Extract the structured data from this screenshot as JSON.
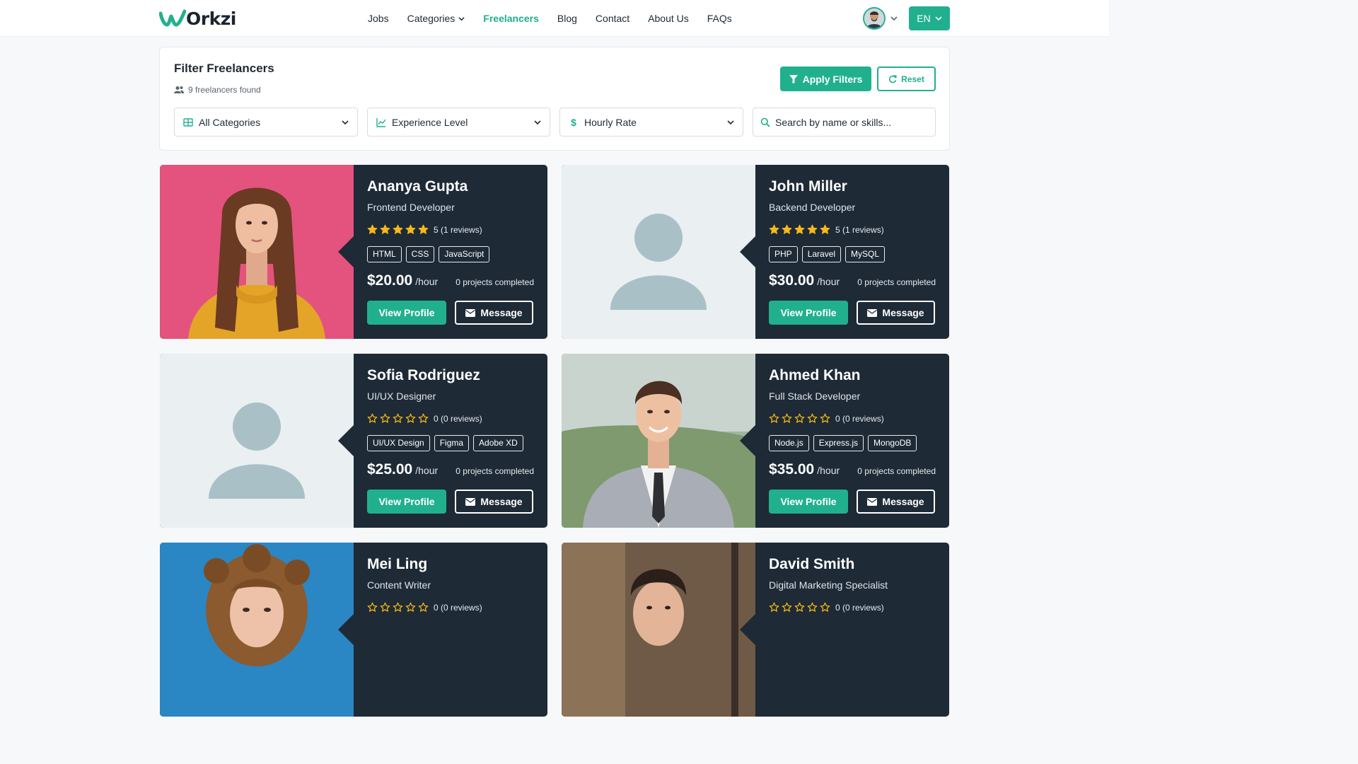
{
  "header": {
    "logo_text": "Orkzi",
    "nav": [
      {
        "label": "Jobs"
      },
      {
        "label": "Categories"
      },
      {
        "label": "Freelancers"
      },
      {
        "label": "Blog"
      },
      {
        "label": "Contact"
      },
      {
        "label": "About Us"
      },
      {
        "label": "FAQs"
      }
    ],
    "active_nav": "Freelancers",
    "language": "EN"
  },
  "filter": {
    "title": "Filter Freelancers",
    "count_text": "9 freelancers found",
    "apply_label": "Apply Filters",
    "reset_label": "Reset",
    "category_select": "All Categories",
    "experience_select": "Experience Level",
    "rate_select": "Hourly Rate",
    "search_placeholder": "Search by name or skills..."
  },
  "freelancers": [
    {
      "name": "Ananya Gupta",
      "role": "Frontend Developer",
      "rating": 5,
      "rating_text": "5 (1 reviews)",
      "skills": [
        "HTML",
        "CSS",
        "JavaScript"
      ],
      "price": "$20.00",
      "per": "/hour",
      "projects": "0 projects completed",
      "photo": "woman-portrait"
    },
    {
      "name": "John Miller",
      "role": "Backend Developer",
      "rating": 5,
      "rating_text": "5 (1 reviews)",
      "skills": [
        "PHP",
        "Laravel",
        "MySQL"
      ],
      "price": "$30.00",
      "per": "/hour",
      "projects": "0 projects completed",
      "photo": "placeholder"
    },
    {
      "name": "Sofia Rodriguez",
      "role": "UI/UX Designer",
      "rating": 0,
      "rating_text": "0 (0 reviews)",
      "skills": [
        "UI/UX Design",
        "Figma",
        "Adobe XD"
      ],
      "price": "$25.00",
      "per": "/hour",
      "projects": "0 projects completed",
      "photo": "placeholder"
    },
    {
      "name": "Ahmed Khan",
      "role": "Full Stack Developer",
      "rating": 0,
      "rating_text": "0 (0 reviews)",
      "skills": [
        "Node.js",
        "Express.js",
        "MongoDB"
      ],
      "price": "$35.00",
      "per": "/hour",
      "projects": "0 projects completed",
      "photo": "man-suit-portrait"
    },
    {
      "name": "Mei Ling",
      "role": "Content Writer",
      "rating": 0,
      "rating_text": "0 (0 reviews)",
      "skills": [],
      "price": "",
      "per": "",
      "projects": "",
      "photo": "woman-curly-portrait"
    },
    {
      "name": "David Smith",
      "role": "Digital Marketing Specialist",
      "rating": 0,
      "rating_text": "0 (0 reviews)",
      "skills": [],
      "price": "",
      "per": "",
      "projects": "",
      "photo": "man-portrait"
    }
  ],
  "card_labels": {
    "view_profile": "View Profile",
    "message": "Message"
  },
  "colors": {
    "accent": "#21b08e",
    "card_bg": "#1e2a36",
    "star": "#f5b91a",
    "page_bg": "#f6f8f9"
  }
}
